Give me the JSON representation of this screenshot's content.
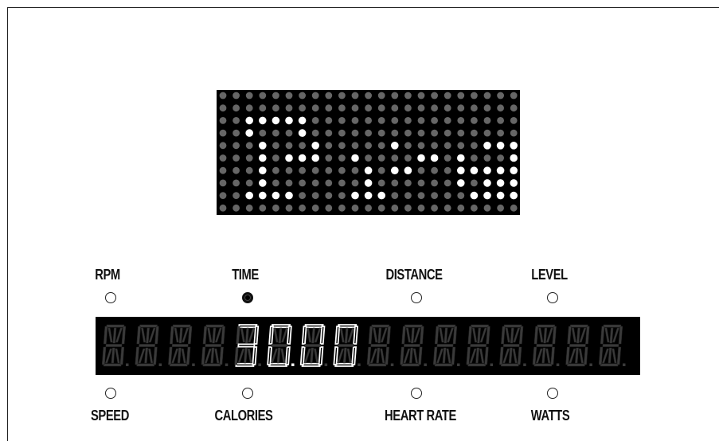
{
  "console": {
    "dot_matrix": {
      "rows": 10,
      "cols": 23,
      "on_color": "#ffffff",
      "off_color": "#666666",
      "lit": [
        [
          2,
          2
        ],
        [
          2,
          3
        ],
        [
          2,
          4
        ],
        [
          2,
          5
        ],
        [
          2,
          6
        ],
        [
          3,
          2
        ],
        [
          3,
          6
        ],
        [
          4,
          3
        ],
        [
          4,
          7
        ],
        [
          4,
          13
        ],
        [
          4,
          20
        ],
        [
          4,
          21
        ],
        [
          4,
          22
        ],
        [
          5,
          3
        ],
        [
          5,
          5
        ],
        [
          5,
          6
        ],
        [
          5,
          7
        ],
        [
          5,
          10
        ],
        [
          5,
          15
        ],
        [
          5,
          16
        ],
        [
          5,
          18
        ],
        [
          5,
          22
        ],
        [
          6,
          3
        ],
        [
          6,
          11
        ],
        [
          6,
          13
        ],
        [
          6,
          14
        ],
        [
          6,
          18
        ],
        [
          6,
          19
        ],
        [
          6,
          20
        ],
        [
          6,
          21
        ],
        [
          6,
          22
        ],
        [
          7,
          3
        ],
        [
          7,
          11
        ],
        [
          7,
          18
        ],
        [
          7,
          20
        ],
        [
          7,
          21
        ],
        [
          7,
          22
        ],
        [
          8,
          2
        ],
        [
          8,
          3
        ],
        [
          8,
          4
        ],
        [
          8,
          5
        ],
        [
          8,
          10
        ],
        [
          8,
          11
        ],
        [
          8,
          12
        ],
        [
          8,
          19
        ],
        [
          8,
          20
        ],
        [
          8,
          21
        ],
        [
          8,
          22
        ]
      ]
    },
    "top_labels": [
      {
        "id": "rpm",
        "text": "RPM",
        "active": false
      },
      {
        "id": "time",
        "text": "TIME",
        "active": true
      },
      {
        "id": "distance",
        "text": "DISTANCE",
        "active": false
      },
      {
        "id": "level",
        "text": "LEVEL",
        "active": false
      }
    ],
    "bottom_labels": [
      {
        "id": "speed",
        "text": "SPEED",
        "active": false
      },
      {
        "id": "calories",
        "text": "CALORIES",
        "active": false
      },
      {
        "id": "heart-rate",
        "text": "HEART RATE",
        "active": false
      },
      {
        "id": "watts",
        "text": "WATTS",
        "active": false
      }
    ],
    "segment_display": {
      "digit_count": 16,
      "value": "30.00",
      "value_start_index": 4,
      "lit_color": "#ffffff",
      "unlit_color": "#3a3a3a"
    }
  }
}
